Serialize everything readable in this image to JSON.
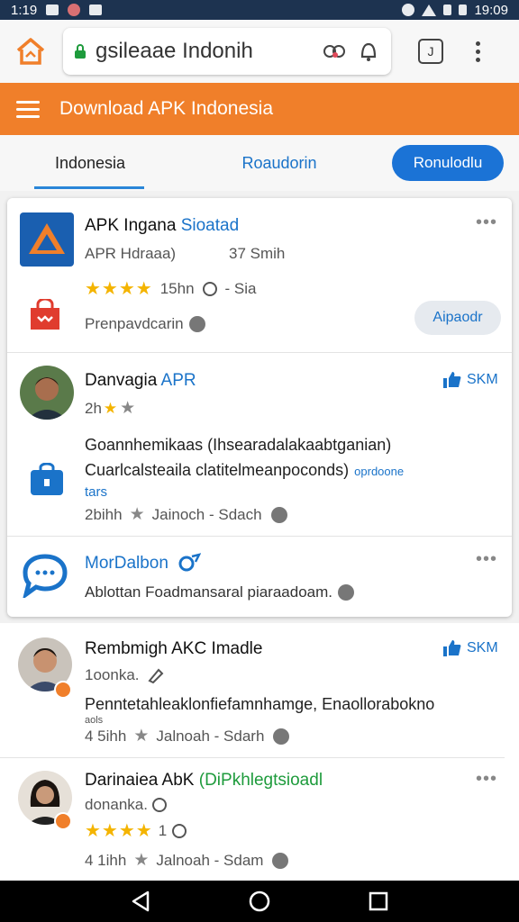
{
  "status_bar": {
    "time_left": "1:19",
    "time_right": "19:09"
  },
  "browser": {
    "url": "gsileaae Indonih",
    "tab_count": "J"
  },
  "site": {
    "title": "Download APK Indonesia"
  },
  "nav": {
    "tab1": "Indonesia",
    "tab2": "Roaudorin",
    "button": "Ronulodlu"
  },
  "apps": [
    {
      "title_main": "APK Ingana ",
      "title_hl": "Sioatad",
      "sub": "APR Hdraaa)",
      "size": "37 Smih",
      "stars": "★★★★",
      "rating_text": "15hn",
      "extra": "- Sia",
      "developer": "Prenpavdcarin",
      "action": "Aipaodr"
    },
    {
      "title_main": "Danvagia ",
      "title_hl": "APR",
      "like": "SKM",
      "rating_prefix": "2h",
      "stars_partial": "★",
      "desc1": "Goannhemikaas (Ihsearadalakaabtganian)",
      "desc2": "Cuarlcalsteaila clatitelmeanpoconds)",
      "desc_link": "oprdoone",
      "desc_link2": "tars",
      "meta": "2bihh",
      "meta2": "Jainoch - Sdach"
    },
    {
      "title_main": "MorDalbon",
      "desc": "Ablottan Foadmansaral piaraadoam."
    }
  ],
  "list": [
    {
      "title": "Rembmigh AKC Imadle",
      "like": "SKM",
      "sub": "1oonka.",
      "desc": "Penntetahleaklonfiefamnhamge, Enaollorabokno",
      "desc_small": "aols",
      "meta": "4 5ihh",
      "meta2": "Jalnoah - Sdarh"
    },
    {
      "title_main": "Darinaiea AbK ",
      "title_hl": "(DiPkhlegtsioadl",
      "sub": "donanka. ",
      "stars": "★★★★",
      "rating": "1",
      "meta": "4 1ihh",
      "meta2": "Jalnoah - Sdam"
    }
  ],
  "colors": {
    "orange": "#f07f2a",
    "blue": "#1b73d6",
    "status": "#1d3350"
  }
}
